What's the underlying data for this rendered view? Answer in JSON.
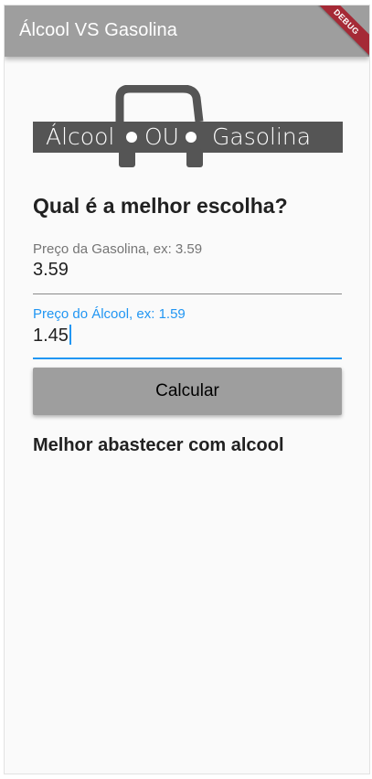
{
  "appbar": {
    "title": "Álcool VS Gasolina",
    "debug_banner": "DEBUG"
  },
  "logo": {
    "word_left": "Álcool",
    "word_middle": "OU",
    "word_right": "Gasolina"
  },
  "form": {
    "heading": "Qual é a melhor escolha?",
    "gasolina": {
      "label": "Preço da Gasolina, ex: 3.59",
      "value": "3.59"
    },
    "alcool": {
      "label": "Preço do Álcool, ex: 1.59",
      "value": "1.45"
    },
    "calculate_label": "Calcular"
  },
  "result": {
    "text": "Melhor abastecer com alcool"
  },
  "colors": {
    "appbar": "#9e9e9e",
    "focus_accent": "#2196f3",
    "logo": "#555555",
    "debug_ribbon": "#a52a36",
    "background": "#fafafa"
  }
}
